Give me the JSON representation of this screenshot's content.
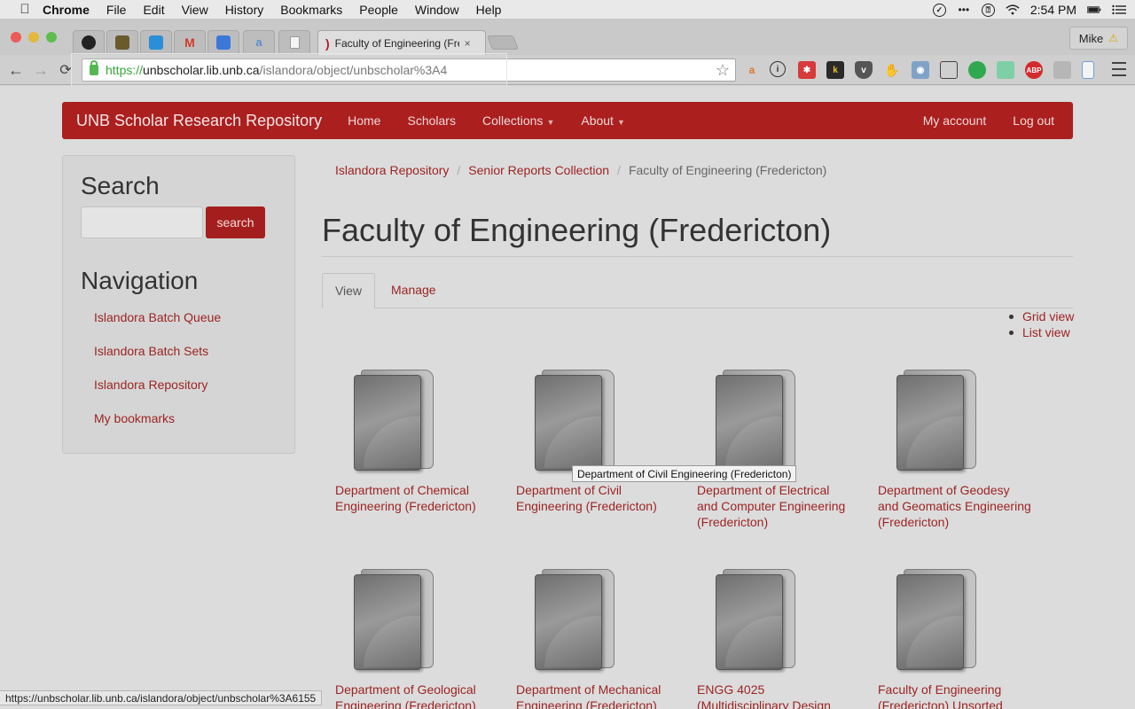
{
  "os_menubar": {
    "app": "Chrome",
    "items": [
      "File",
      "Edit",
      "View",
      "History",
      "Bookmarks",
      "People",
      "Window",
      "Help"
    ],
    "clock": "2:54 PM"
  },
  "browser": {
    "active_tab_title": "Faculty of Engineering (Fre",
    "tab_close": "×",
    "profile_name": "Mike",
    "url": {
      "scheme": "https://",
      "host": "unbscholar.lib.unb.ca",
      "path": "/islandora/object/unbscholar%3A4"
    },
    "status_url": "https://unbscholar.lib.unb.ca/islandora/object/unbscholar%3A6155",
    "extension_abp": "ABP",
    "extension_k": "k"
  },
  "site": {
    "brand": "UNB Scholar Research Repository",
    "nav": {
      "home": "Home",
      "scholars": "Scholars",
      "collections": "Collections",
      "about": "About",
      "my_account": "My account",
      "log_out": "Log out"
    }
  },
  "sidebar": {
    "search_heading": "Search",
    "search_button": "search",
    "nav_heading": "Navigation",
    "links": [
      "Islandora Batch Queue",
      "Islandora Batch Sets",
      "Islandora Repository",
      "My bookmarks"
    ]
  },
  "breadcrumb": {
    "items": [
      "Islandora Repository",
      "Senior Reports Collection"
    ],
    "current": "Faculty of Engineering (Fredericton)",
    "sep": "/"
  },
  "main": {
    "title": "Faculty of Engineering (Fredericton)",
    "tabs": {
      "view": "View",
      "manage": "Manage"
    },
    "view_options": [
      "Grid view",
      "List view"
    ],
    "items": [
      {
        "line1": "Department of Chemical",
        "line2": "Engineering (Fredericton)",
        "line3": ""
      },
      {
        "line1": "Department of Civil",
        "line2": "Engineering (Fredericton)",
        "line3": ""
      },
      {
        "line1": "Department of Electrical",
        "line2": "and Computer Engineering",
        "line3": "(Fredericton)"
      },
      {
        "line1": "Department of Geodesy",
        "line2": "and Geomatics Engineering",
        "line3": "(Fredericton)"
      },
      {
        "line1": "Department of Geological",
        "line2": "Engineering (Fredericton)",
        "line3": ""
      },
      {
        "line1": "Department of Mechanical",
        "line2": "Engineering (Fredericton)",
        "line3": ""
      },
      {
        "line1": "ENGG 4025",
        "line2": "(Multidisciplinary Design",
        "line3": ""
      },
      {
        "line1": "Faculty of Engineering",
        "line2": "(Fredericton) Unsorted",
        "line3": ""
      }
    ],
    "tooltip": "Department of Civil Engineering (Fredericton)"
  }
}
